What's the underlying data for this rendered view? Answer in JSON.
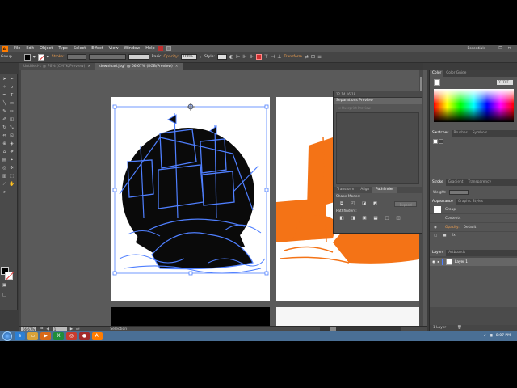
{
  "menu": {
    "app_logo": "Ai",
    "items": [
      "File",
      "Edit",
      "Object",
      "Type",
      "Select",
      "Effect",
      "View",
      "Window",
      "Help"
    ],
    "workspace": "Essentials",
    "window_controls": [
      "–",
      "❐",
      "✕"
    ]
  },
  "control": {
    "group_label": "Group",
    "stroke_label": "Stroke:",
    "basic_label": "Basic",
    "opacity_label": "Opacity:",
    "opacity_value": "100%",
    "style_label": "Style:",
    "transform_label": "Transform"
  },
  "tabs": [
    {
      "label": "Untitled-1 @ 76% (CMYK/Preview)",
      "close": "×",
      "active": false
    },
    {
      "label": "download.jpg* @ 66.67% (RGB/Preview)",
      "close": "×",
      "active": true
    }
  ],
  "float_panel": {
    "ruler_numbers": "12      14      16      18",
    "separations_title": "Separations Preview",
    "overprint_label": "Overprint Preview",
    "tabs": [
      "Transform",
      "Align",
      "Pathfinder"
    ],
    "shape_modes_label": "Shape Modes:",
    "expand_label": "Expand",
    "pathfinders_label": "Pathfinders:"
  },
  "dock": {
    "color_tabs": [
      "Color",
      "Color Guide"
    ],
    "hex_value": "FFFFFF",
    "swatch_tabs": [
      "Swatches",
      "Brushes",
      "Symbols"
    ],
    "stroke_tabs": [
      "Stroke",
      "Gradient",
      "Transparency"
    ],
    "weight_label": "Weight:",
    "appearance_tabs": [
      "Appearance",
      "Graphic Styles"
    ],
    "appearance_rows": [
      {
        "label": "Group"
      },
      {
        "label": "Contents"
      },
      {
        "label": "Opacity:",
        "value": "Default"
      }
    ],
    "appearance_foot": [
      "□",
      "■",
      "fx."
    ],
    "layers_tabs": [
      "Layers",
      "Artboards"
    ],
    "layer_name": "Layer 1",
    "layers_count": "1 Layer"
  },
  "status": {
    "zoom": "66.67%",
    "page": "1",
    "tool": "Selection"
  },
  "taskbar": {
    "time": "8:07 PM",
    "apps": [
      {
        "name": "ie",
        "color": "#2b7fd4",
        "glyph": "e"
      },
      {
        "name": "folder",
        "color": "#d8a23a",
        "glyph": "▭"
      },
      {
        "name": "media",
        "color": "#d96a1a",
        "glyph": "▶"
      },
      {
        "name": "excel",
        "color": "#1f8d3a",
        "glyph": "X"
      },
      {
        "name": "chrome",
        "color": "#c93b2e",
        "glyph": "◎"
      },
      {
        "name": "winamp",
        "color": "#a32a2a",
        "glyph": "●"
      },
      {
        "name": "illustrator",
        "color": "#ff7c00",
        "glyph": "Ai"
      }
    ]
  },
  "colors": {
    "selection_blue": "#4f7fff",
    "ink_black": "#0a0a0a",
    "orange_fill": "#f47316"
  }
}
